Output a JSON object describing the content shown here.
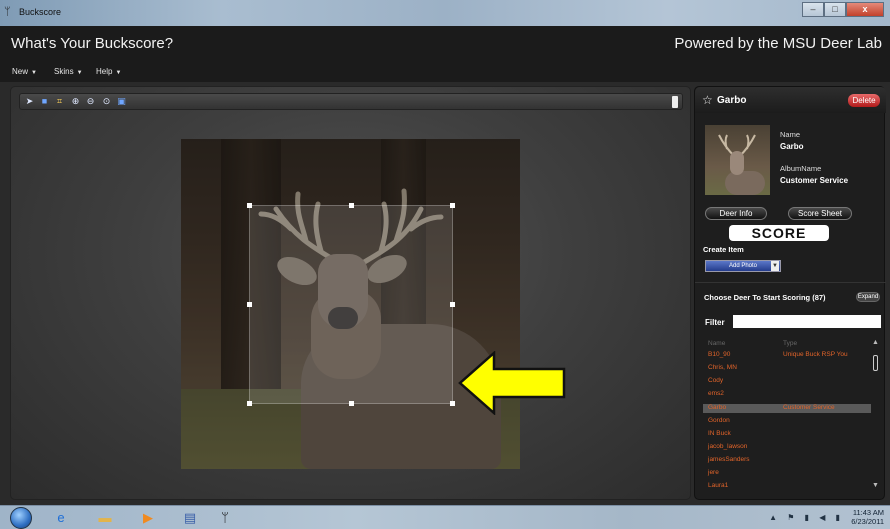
{
  "window": {
    "title": "Buckscore",
    "controls": {
      "minimize": "–",
      "maximize": "□",
      "close": "x"
    }
  },
  "header": {
    "title": "What's Your Buckscore?",
    "powered_by": "Powered by the MSU Deer Lab"
  },
  "menu": [
    {
      "label": "New"
    },
    {
      "label": "Skins"
    },
    {
      "label": "Help"
    }
  ],
  "toolbar": {
    "tools": [
      "pointer-icon",
      "save-icon",
      "crop-icon",
      "zoom-in-icon",
      "zoom-out-icon",
      "zoom-fit-icon",
      "fullscreen-icon"
    ]
  },
  "deer_panel": {
    "name": "Garbo",
    "delete_label": "Delete",
    "name_label": "Name",
    "name_value": "Garbo",
    "album_label": "AlbumName",
    "album_value": "Customer Service",
    "deer_info_label": "Deer Info",
    "score_sheet_label": "Score Sheet",
    "score_label": "SCORE",
    "create_item_label": "Create Item",
    "add_photo_label": "Add Photo"
  },
  "deer_list": {
    "title": "Choose Deer To Start Scoring (87)",
    "expand_label": "Expand",
    "filter_label": "Filter",
    "filter_value": "",
    "columns": [
      "Name",
      "Type"
    ],
    "rows": [
      {
        "name": "B10_90",
        "type": "Unique Buck RSP You"
      },
      {
        "name": "Chris, MN",
        "type": ""
      },
      {
        "name": "Cody",
        "type": ""
      },
      {
        "name": "ems2",
        "type": ""
      },
      {
        "name": "Garbo",
        "type": "Customer Service",
        "selected": true
      },
      {
        "name": "Gordon",
        "type": ""
      },
      {
        "name": "IN Buck",
        "type": ""
      },
      {
        "name": "jacob_lawson",
        "type": ""
      },
      {
        "name": "jamesSanders",
        "type": ""
      },
      {
        "name": "jere",
        "type": ""
      },
      {
        "name": "Laura1",
        "type": ""
      }
    ]
  },
  "taskbar": {
    "time": "11:43 AM",
    "date": "6/23/2011"
  },
  "colors": {
    "accent_orange": "#e2642a",
    "arrow_yellow": "#ffff00",
    "delete_red": "#c62828",
    "add_photo_blue": "#3a56aa"
  }
}
